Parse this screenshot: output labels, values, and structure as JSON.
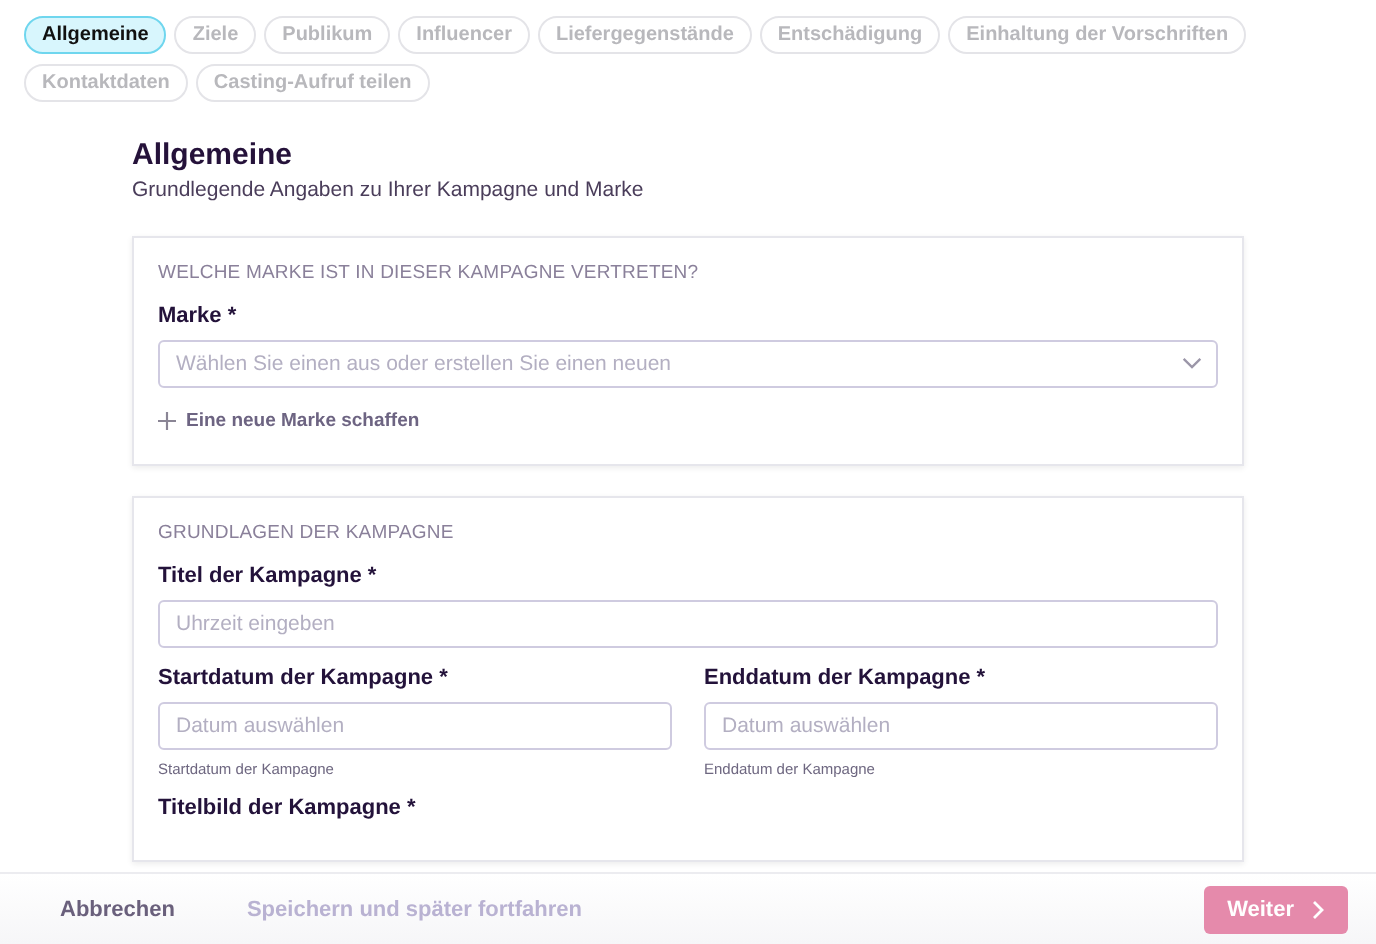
{
  "tabs": [
    {
      "label": "Allgemeine",
      "selected": true
    },
    {
      "label": "Ziele",
      "selected": false
    },
    {
      "label": "Publikum",
      "selected": false
    },
    {
      "label": "Influencer",
      "selected": false
    },
    {
      "label": "Liefergegenstände",
      "selected": false
    },
    {
      "label": "Entschädigung",
      "selected": false
    },
    {
      "label": "Einhaltung der Vorschriften",
      "selected": false
    },
    {
      "label": "Kontaktdaten",
      "selected": false
    },
    {
      "label": "Casting-Aufruf teilen",
      "selected": false
    }
  ],
  "page": {
    "title": "Allgemeine",
    "subtitle": "Grundlegende Angaben zu Ihrer Kampagne und Marke"
  },
  "sections": [
    {
      "heading": "WELCHE MARKE IST IN DIESER KAMPAGNE VERTRETEN?",
      "rows": [
        {
          "fields": [
            {
              "kind": "select",
              "label": "Marke *",
              "placeholder": "Wählen Sie einen aus oder erstellen Sie einen neuen"
            }
          ]
        },
        {
          "fields": [
            {
              "kind": "add",
              "label": "Eine neue Marke schaffen"
            }
          ]
        }
      ]
    },
    {
      "heading": "GRUNDLAGEN DER KAMPAGNE",
      "rows": [
        {
          "fields": [
            {
              "kind": "input",
              "label": "Titel der Kampagne *",
              "placeholder": "Uhrzeit eingeben"
            }
          ]
        },
        {
          "fields": [
            {
              "kind": "input",
              "label": "Startdatum der Kampagne *",
              "placeholder": "Datum auswählen",
              "hint": "Startdatum der Kampagne"
            },
            {
              "kind": "input",
              "label": "Enddatum der Kampagne *",
              "placeholder": "Datum auswählen",
              "hint": "Enddatum der Kampagne"
            }
          ]
        },
        {
          "fields": [
            {
              "kind": "label",
              "label": "Titelbild der Kampagne *"
            }
          ]
        }
      ]
    }
  ],
  "footer": {
    "cancel": "Abbrechen",
    "save": "Speichern und später fortfahren",
    "next": {
      "label": "Weiter",
      "disabled": true
    }
  }
}
